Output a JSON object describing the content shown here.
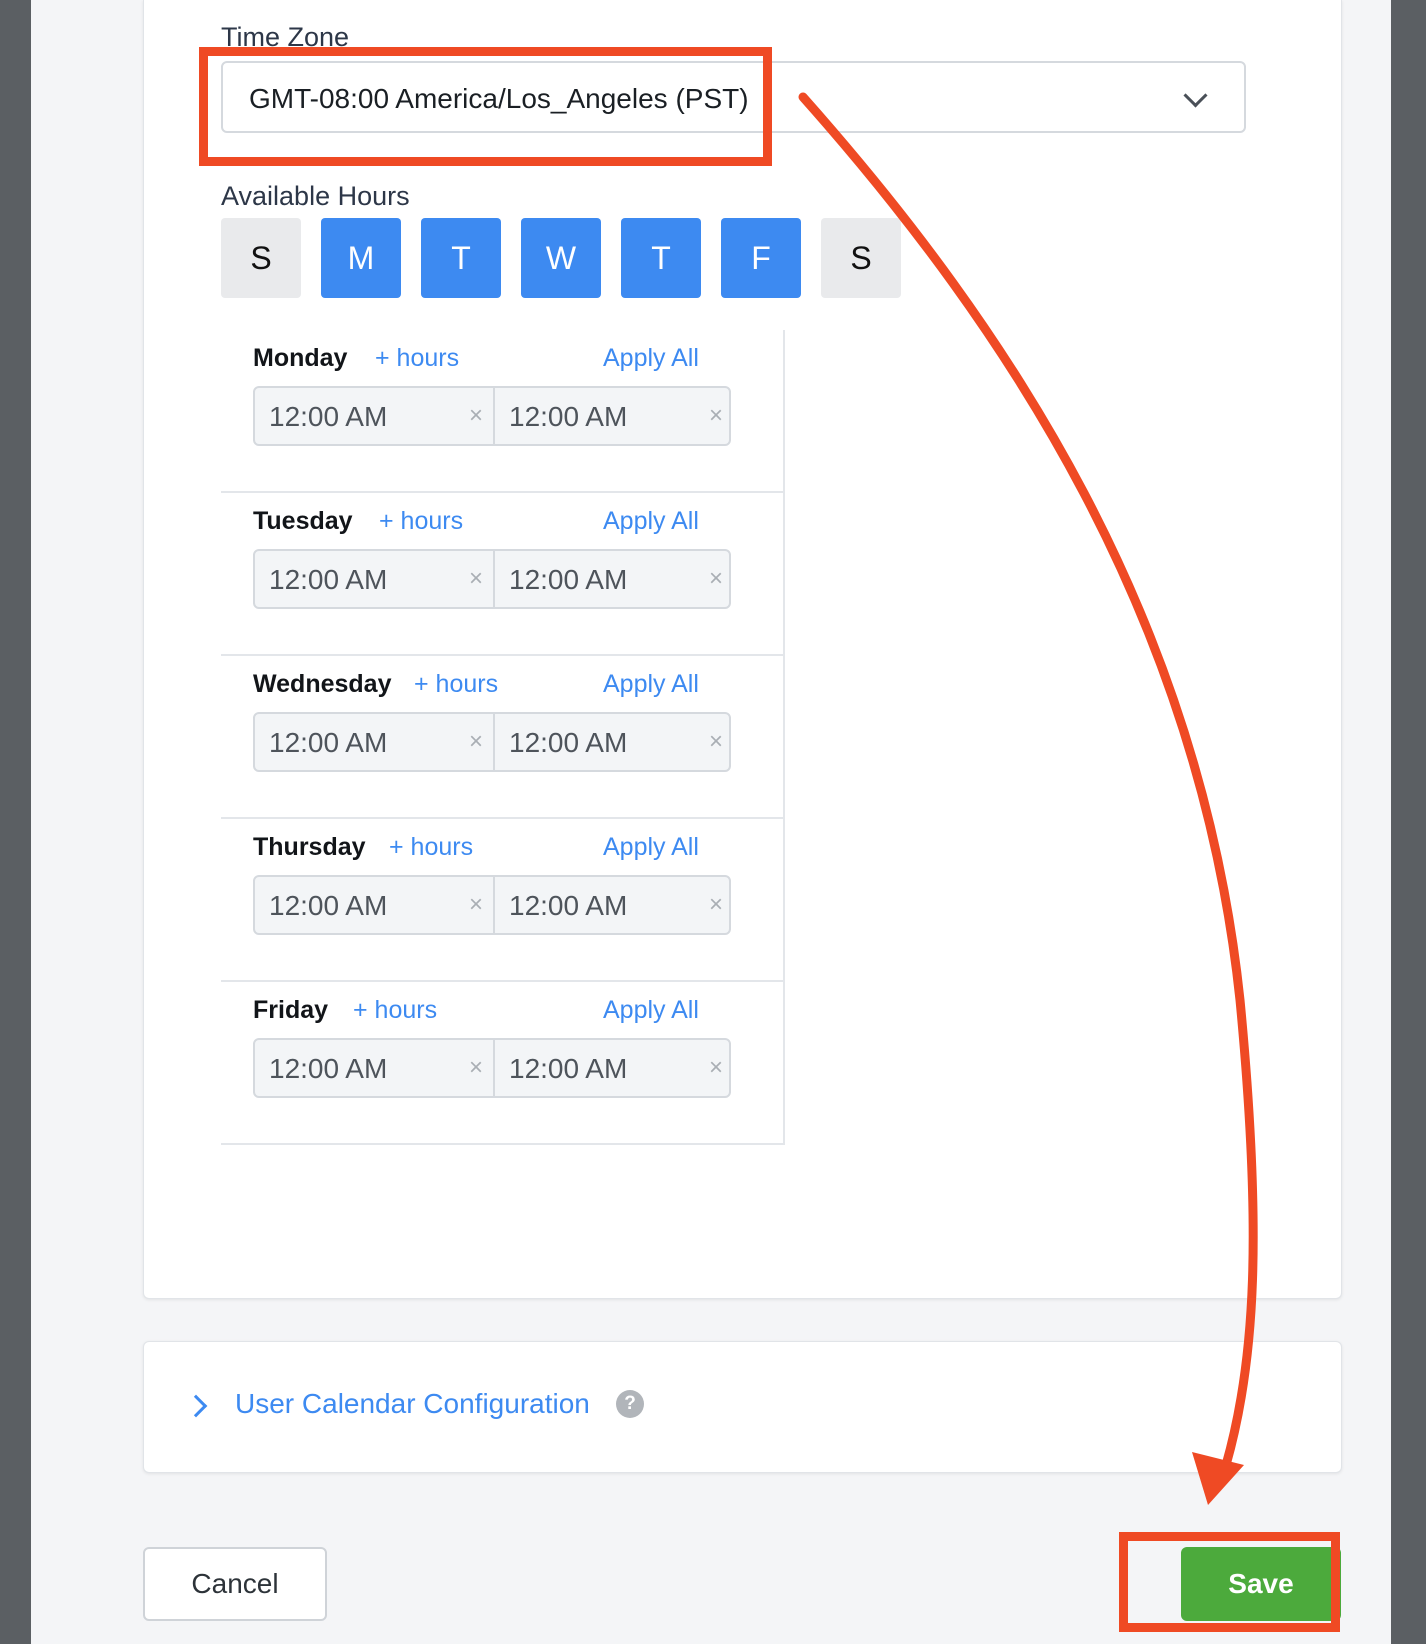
{
  "timezone": {
    "label": "Time Zone",
    "value": "GMT-08:00 America/Los_Angeles (PST)"
  },
  "available_hours": {
    "label": "Available Hours",
    "days": [
      {
        "letter": "S",
        "selected": false
      },
      {
        "letter": "M",
        "selected": true
      },
      {
        "letter": "T",
        "selected": true
      },
      {
        "letter": "W",
        "selected": true
      },
      {
        "letter": "T",
        "selected": true
      },
      {
        "letter": "F",
        "selected": true
      },
      {
        "letter": "S",
        "selected": false
      }
    ],
    "schedule": [
      {
        "day": "Monday",
        "add_hours": "+ hours",
        "apply_all": "Apply All",
        "start": "12:00 AM",
        "end": "12:00 AM"
      },
      {
        "day": "Tuesday",
        "add_hours": "+ hours",
        "apply_all": "Apply All",
        "start": "12:00 AM",
        "end": "12:00 AM"
      },
      {
        "day": "Wednesday",
        "add_hours": "+ hours",
        "apply_all": "Apply All",
        "start": "12:00 AM",
        "end": "12:00 AM"
      },
      {
        "day": "Thursday",
        "add_hours": "+ hours",
        "apply_all": "Apply All",
        "start": "12:00 AM",
        "end": "12:00 AM"
      },
      {
        "day": "Friday",
        "add_hours": "+ hours",
        "apply_all": "Apply All",
        "start": "12:00 AM",
        "end": "12:00 AM"
      }
    ],
    "clear_glyph": "×"
  },
  "calendar_config": {
    "title": "User Calendar Configuration",
    "help_glyph": "?"
  },
  "footer": {
    "cancel_label": "Cancel",
    "save_label": "Save"
  },
  "colors": {
    "accent": "#3d8af1",
    "save": "#4caa3c",
    "annotation": "#ef4a24"
  },
  "icons": {
    "timezone_dropdown": "chevron-down-icon",
    "calendar_expand": "chevron-right-icon",
    "help": "question-circle-icon",
    "clear": "close-icon"
  }
}
